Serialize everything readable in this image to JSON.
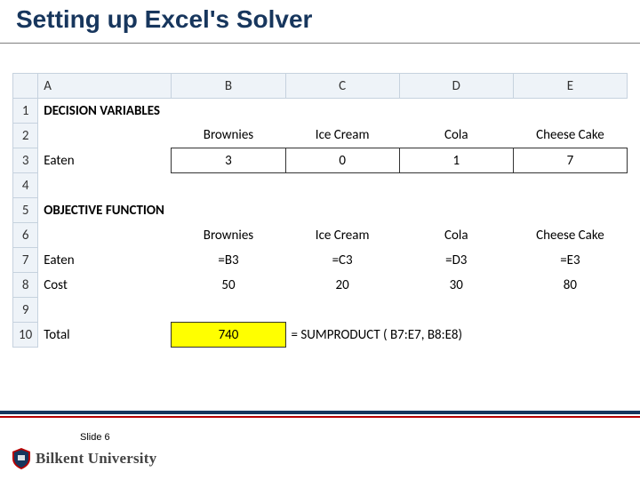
{
  "title": "Setting up Excel's Solver",
  "columns": [
    "A",
    "B",
    "C",
    "D",
    "E"
  ],
  "rows": [
    "1",
    "2",
    "3",
    "4",
    "5",
    "6",
    "7",
    "8",
    "9",
    "10"
  ],
  "section": {
    "decision": "DECISION VARIABLES",
    "objective": "OBJECTIVE FUNCTION"
  },
  "items": {
    "b": "Brownies",
    "c": "Ice Cream",
    "d": "Cola",
    "e": "Cheese Cake"
  },
  "labels": {
    "eaten": "Eaten",
    "cost": "Cost",
    "total": "Total"
  },
  "dv_values": {
    "b": "3",
    "c": "0",
    "d": "1",
    "e": "7"
  },
  "of_eaten": {
    "b": "=B3",
    "c": "=C3",
    "d": "=D3",
    "e": "=E3"
  },
  "of_cost": {
    "b": "50",
    "c": "20",
    "d": "30",
    "e": "80"
  },
  "total_value": "740",
  "total_formula": "= SUMPRODUCT ( B7:E7, B8:E8)",
  "slide_label": "Slide 6",
  "university": "Bilkent University",
  "chart_data": {
    "type": "table",
    "title": "Setting up Excel's Solver",
    "sections": [
      {
        "name": "DECISION VARIABLES",
        "columns": [
          "Brownies",
          "Ice Cream",
          "Cola",
          "Cheese Cake"
        ],
        "rows": [
          {
            "label": "Eaten",
            "values": [
              3,
              0,
              1,
              7
            ]
          }
        ]
      },
      {
        "name": "OBJECTIVE FUNCTION",
        "columns": [
          "Brownies",
          "Ice Cream",
          "Cola",
          "Cheese Cake"
        ],
        "rows": [
          {
            "label": "Eaten",
            "values": [
              "=B3",
              "=C3",
              "=D3",
              "=E3"
            ]
          },
          {
            "label": "Cost",
            "values": [
              50,
              20,
              30,
              80
            ]
          }
        ],
        "total": {
          "value": 740,
          "formula": "=SUMPRODUCT(B7:E7, B8:E8)"
        }
      }
    ]
  }
}
